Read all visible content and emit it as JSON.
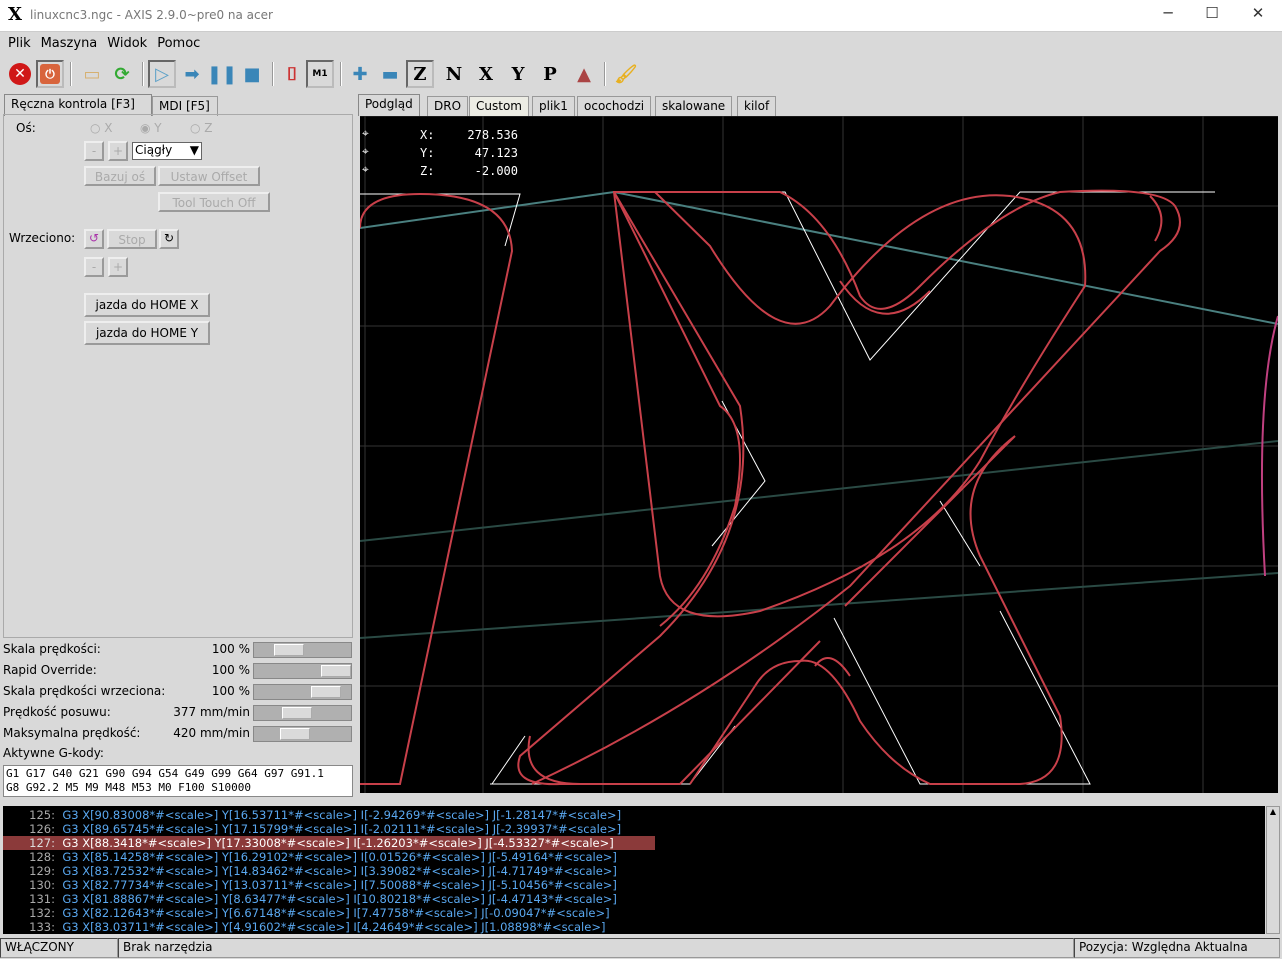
{
  "window": {
    "title": "linuxcnc3.ngc - AXIS 2.9.0~pre0 na acer",
    "minimize": "─",
    "maximize": "☐",
    "close": "✕"
  },
  "menu": [
    "Plik",
    "Maszyna",
    "Widok",
    "Pomoc"
  ],
  "toolbar": {
    "m1_label": "M1",
    "icons": [
      "estop-icon",
      "power-icon",
      "open-file-icon",
      "reload-icon",
      "run-icon",
      "step-icon",
      "pause-icon",
      "stop-icon",
      "optional-block-delete-icon",
      "optional-stop-icon",
      "zoom-in-icon",
      "zoom-out-icon",
      "view-z-icon",
      "view-z-rotated-icon",
      "view-x-icon",
      "view-y-icon",
      "view-p-icon",
      "rotate-view-icon",
      "clear-plot-icon"
    ]
  },
  "left_tabs": [
    "Ręczna kontrola [F3]",
    "MDI [F5]"
  ],
  "right_tabs": [
    "Podgląd",
    "DRO",
    "Custom",
    "plik1",
    "ocochodzi",
    "skalowane",
    "kilof"
  ],
  "manual": {
    "axis_label": "Oś:",
    "axes": [
      "X",
      "Y",
      "Z"
    ],
    "selected_axis": "Y",
    "minus": "-",
    "plus": "+",
    "jog_mode": "Ciągły",
    "home_axis": "Bazuj oś",
    "touch_off": "Ustaw Offset",
    "tool_touch_off": "Tool Touch Off",
    "spindle_label": "Wrzeciono:",
    "spindle_stop": "Stop",
    "home_x": "jazda do HOME X",
    "home_y": "jazda do HOME Y"
  },
  "overrides": [
    {
      "label": "Skala prędkości:",
      "value": "100 %",
      "fraction": 0.3
    },
    {
      "label": "Rapid Override:",
      "value": "100 %",
      "fraction": 1.0
    },
    {
      "label": "Skala prędkości wrzeciona:",
      "value": "100 %",
      "fraction": 0.85
    },
    {
      "label": "Prędkość posuwu:",
      "value": "377 mm/min",
      "fraction": 0.42
    },
    {
      "label": "Maksymalna prędkość:",
      "value": "420 mm/min",
      "fraction": 0.39
    }
  ],
  "gcodes_label": "Aktywne G-kody:",
  "gcodes": [
    "G1 G17 G40 G21 G90 G94 G54 G49 G99 G64 G97 G91.1",
    "G8 G92.2 M5 M9 M48 M53 M0 F100 S10000"
  ],
  "dro": [
    {
      "axis": "X:",
      "value": "278.536"
    },
    {
      "axis": "Y:",
      "value": "47.123"
    },
    {
      "axis": "Z:",
      "value": "-2.000"
    }
  ],
  "code_lines": [
    {
      "n": "125:",
      "text": "G3 X[90.83008*#<scale>] Y[16.53711*#<scale>] I[-2.94269*#<scale>] J[-1.28147*#<scale>]"
    },
    {
      "n": "126:",
      "text": "G3 X[89.65745*#<scale>] Y[17.15799*#<scale>] I[-2.02111*#<scale>] J[-2.39937*#<scale>]"
    },
    {
      "n": "127:",
      "text": "G3 X[88.3418*#<scale>] Y[17.33008*#<scale>] I[-1.26203*#<scale>] J[-4.53327*#<scale>]",
      "active": true
    },
    {
      "n": "128:",
      "text": "G3 X[85.14258*#<scale>] Y[16.29102*#<scale>] I[0.01526*#<scale>] J[-5.49164*#<scale>]"
    },
    {
      "n": "129:",
      "text": "G3 X[83.72532*#<scale>] Y[14.83462*#<scale>] I[3.39082*#<scale>] J[-4.71749*#<scale>]"
    },
    {
      "n": "130:",
      "text": "G3 X[82.77734*#<scale>] Y[13.03711*#<scale>] I[7.50088*#<scale>] J[-5.10456*#<scale>]"
    },
    {
      "n": "131:",
      "text": "G3 X[81.88867*#<scale>] Y[8.63477*#<scale>] I[10.80218*#<scale>] J[-4.47143*#<scale>]"
    },
    {
      "n": "132:",
      "text": "G3 X[82.12643*#<scale>] Y[6.67148*#<scale>] I[7.47758*#<scale>] J[-0.09047*#<scale>]"
    },
    {
      "n": "133:",
      "text": "G3 X[83.03711*#<scale>] Y[4.91602*#<scale>] I[4.24649*#<scale>] J[1.08898*#<scale>]"
    }
  ],
  "status": {
    "machine": "WŁĄCZONY",
    "tool": "Brak narzędzia",
    "position": "Pozycja: Względna Aktualna"
  },
  "colors": {
    "toolpath": "#c8404a",
    "rapid": "#4a8080",
    "highlight": "#8b3a3a",
    "code_text": "#5aa8f0"
  }
}
